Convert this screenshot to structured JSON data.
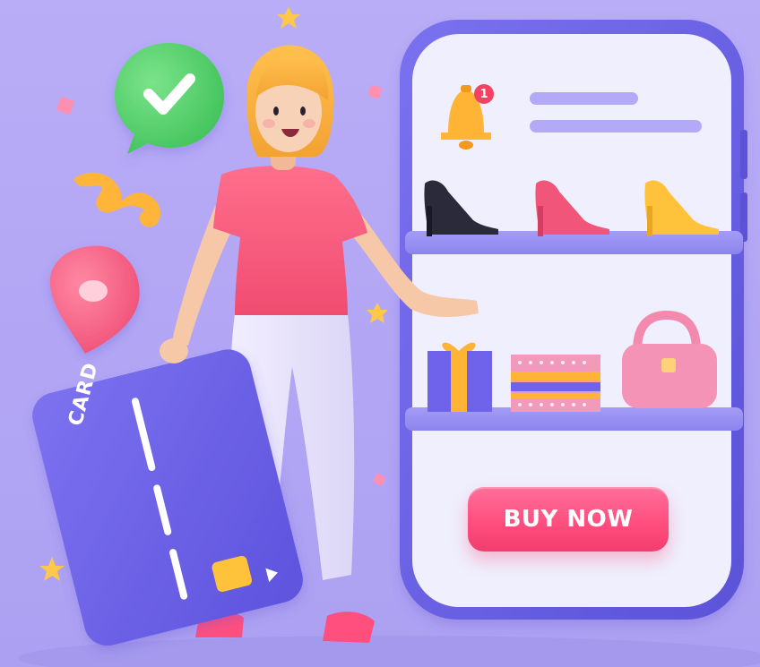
{
  "button": {
    "buy_now_label": "BUY NOW"
  },
  "notification": {
    "count": "1"
  },
  "card": {
    "label": "CARD"
  },
  "shelves": {
    "top": [
      "black-heel",
      "pink-heel",
      "yellow-heel"
    ],
    "bottom": [
      "gift-box",
      "patterned-box",
      "pink-handbag"
    ]
  },
  "colors": {
    "background": "#B4A7F6",
    "phone_frame": "#6B63E6",
    "phone_screen": "#EFEFFD",
    "buy_now": "#FF4F7F",
    "card": "#6E63EA",
    "shirt": "#F7587A"
  }
}
